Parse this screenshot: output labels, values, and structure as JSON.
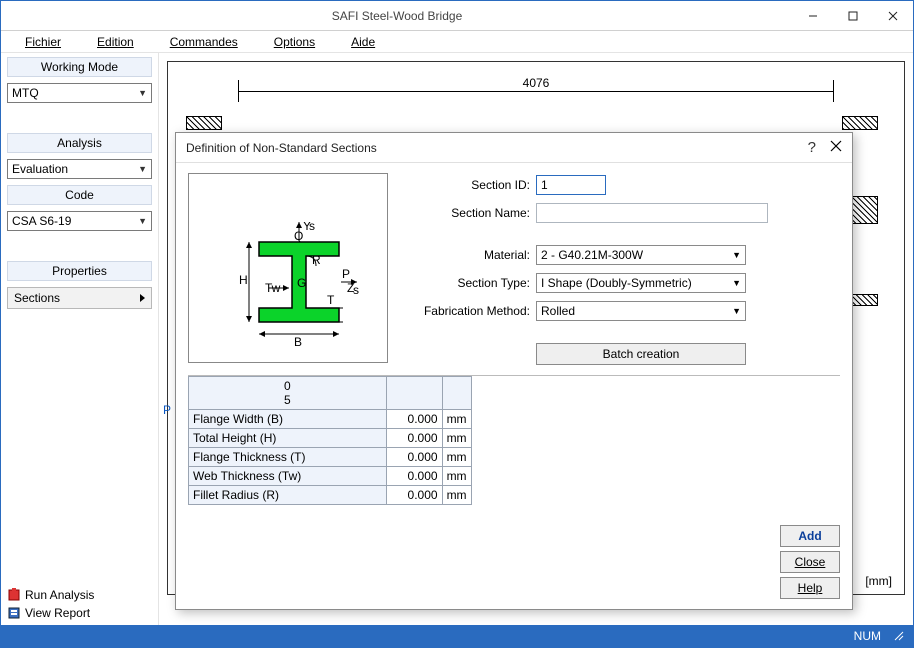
{
  "window": {
    "title": "SAFI Steel-Wood Bridge"
  },
  "menu": {
    "file": "Fichier",
    "edit": "Edition",
    "commands": "Commandes",
    "options": "Options",
    "help": "Aide"
  },
  "sidebar": {
    "workingMode": {
      "title": "Working Mode",
      "value": "MTQ"
    },
    "analysis": {
      "title": "Analysis",
      "value": "Evaluation"
    },
    "code": {
      "title": "Code",
      "value": "CSA S6-19"
    },
    "properties": {
      "title": "Properties",
      "sections": "Sections"
    },
    "runAnalysis": "Run Analysis",
    "viewReport": "View Report"
  },
  "canvas": {
    "dimension": "4076",
    "unit": "[mm]",
    "pLetter": "P"
  },
  "dialog": {
    "title": "Definition of Non-Standard Sections",
    "labels": {
      "sectionId": "Section ID:",
      "sectionName": "Section Name:",
      "material": "Material:",
      "sectionType": "Section Type:",
      "fabMethod": "Fabrication Method:"
    },
    "values": {
      "sectionId": "1",
      "sectionName": "",
      "material": "2 - G40.21M-300W",
      "sectionType": "I Shape (Doubly-Symmetric)",
      "fabMethod": "Rolled"
    },
    "batch": "Batch creation",
    "gridHeader": {
      "c1": "0",
      "c2": "5"
    },
    "rows": [
      {
        "label": "Flange Width (B)",
        "value": "0.000",
        "unit": "mm"
      },
      {
        "label": "Total Height (H)",
        "value": "0.000",
        "unit": "mm"
      },
      {
        "label": "Flange Thickness (T)",
        "value": "0.000",
        "unit": "mm"
      },
      {
        "label": "Web Thickness (Tw)",
        "value": "0.000",
        "unit": "mm"
      },
      {
        "label": "Fillet Radius (R)",
        "value": "0.000",
        "unit": "mm"
      }
    ],
    "buttons": {
      "add": "Add",
      "close": "Close",
      "help": "Help"
    }
  },
  "status": {
    "num": "NUM"
  }
}
